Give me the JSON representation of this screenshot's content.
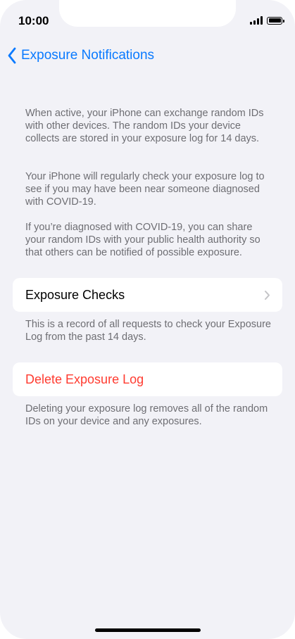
{
  "status_bar": {
    "time": "10:00"
  },
  "nav": {
    "back_label": "Exposure Notifications"
  },
  "intro": {
    "paragraphs": [
      "When active, your iPhone can exchange random IDs with other devices. The random IDs your device collects are stored in your exposure log for 14 days.",
      "Your iPhone will regularly check your exposure log to see if you may have been near someone diagnosed with COVID-19.",
      "If you’re diagnosed with COVID-19, you can share your random IDs with your public health authority so that others can be notified of possible exposure."
    ]
  },
  "exposure_checks": {
    "label": "Exposure Checks",
    "footer": "This is a record of all requests to check your Exposure Log from the past 14 days."
  },
  "delete_log": {
    "label": "Delete Exposure Log",
    "footer": "Deleting your exposure log removes all of the random IDs on your device and any exposures."
  },
  "colors": {
    "accent": "#0a7aff",
    "destructive": "#ff3b30",
    "background": "#f2f2f7"
  }
}
